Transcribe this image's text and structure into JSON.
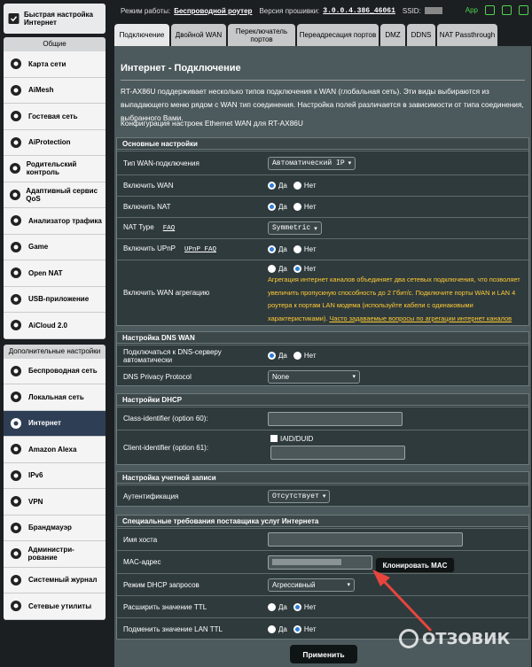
{
  "topbar": {
    "mode_label": "Режим работы:",
    "mode_value": "Беспроводной роутер",
    "fw_label": "Версия прошивки:",
    "fw_value": "3.0.0.4.386_46061",
    "ssid_label": "SSID:",
    "app_label": "App"
  },
  "sidebar": {
    "quick": "Быстрая настройка Интернет",
    "general_header": "Общие",
    "general": [
      {
        "label": "Карта сети",
        "icon": "network-map-icon"
      },
      {
        "label": "AiMesh",
        "icon": "aimesh-icon"
      },
      {
        "label": "Гостевая сеть",
        "icon": "guest-network-icon"
      },
      {
        "label": "AiProtection",
        "icon": "shield-icon"
      },
      {
        "label": "Родительский контроль",
        "icon": "parental-icon"
      },
      {
        "label": "Адаптивный сервис QoS",
        "icon": "qos-icon"
      },
      {
        "label": "Анализатор трафика",
        "icon": "traffic-icon"
      },
      {
        "label": "Game",
        "icon": "gamepad-icon"
      },
      {
        "label": "Open NAT",
        "icon": "open-nat-icon"
      },
      {
        "label": "USB-приложение",
        "icon": "usb-icon"
      },
      {
        "label": "AiCloud 2.0",
        "icon": "cloud-icon"
      }
    ],
    "advanced_header": "Дополнительные настройки",
    "advanced": [
      {
        "label": "Беспроводная сеть",
        "icon": "wireless-icon"
      },
      {
        "label": "Локальная сеть",
        "icon": "lan-icon"
      },
      {
        "label": "Интернет",
        "icon": "globe-icon"
      },
      {
        "label": "Amazon Alexa",
        "icon": "alexa-icon"
      },
      {
        "label": "IPv6",
        "icon": "ipv6-icon"
      },
      {
        "label": "VPN",
        "icon": "vpn-icon"
      },
      {
        "label": "Брандмауэр",
        "icon": "firewall-icon"
      },
      {
        "label": "Администри-рование",
        "icon": "admin-icon"
      },
      {
        "label": "Системный журнал",
        "icon": "log-icon"
      },
      {
        "label": "Сетевые утилиты",
        "icon": "tools-icon"
      }
    ]
  },
  "tabs": [
    "Подключение",
    "Двойной WAN",
    "Переключатель портов",
    "Переадресация портов",
    "DMZ",
    "DDNS",
    "NAT Passthrough"
  ],
  "page": {
    "title": "Интернет - Подключение",
    "description": "RT-AX86U поддерживает несколько типов подключения к WAN (глобальная сеть). Эти виды выбираются из выпадающего меню рядом с WAN тип соединения. Настройка полей различается в зависимости от типа соединения, выбранного Вами.",
    "config": "Конфигурация настроек Ethernet WAN для RT-AX86U"
  },
  "basic": {
    "header": "Основные настройки",
    "wan_type_label": "Тип WAN-подключения",
    "wan_type_value": "Автоматический IP",
    "enable_wan_label": "Включить WAN",
    "enable_nat_label": "Включить NAT",
    "nat_type_label": "NAT Type",
    "nat_faq": "FAQ",
    "nat_type_value": "Symmetric",
    "upnp_label": "Включить UPnP",
    "upnp_faq": "UPnP  FAQ",
    "agg_label": "Включить WAN агрегацию",
    "yes": "Да",
    "no": "Нет",
    "agg_note": "Агрегация интернет каналов объединяет два сетевых подключения, что позволяет увеличить пропускную способность до 2 Гбит/с. Подключите порты WAN и LAN 4 роутера к портам LAN модема (используйте кабели с одинаковыми характеристиками).",
    "agg_link": "Часто задаваемые вопросы по агрегации интернет каналов"
  },
  "dns": {
    "header": "Настройка DNS WAN",
    "auto_label": "Подключаться к DNS-серверу автоматически",
    "privacy_label": "DNS Privacy Protocol",
    "privacy_value": "None"
  },
  "dhcp": {
    "header": "Настройки DHCP",
    "class_label": "Class-identifier (option 60):",
    "client_label": "Client-identifier (option 61):",
    "iaid_label": "IAID/DUID"
  },
  "account": {
    "header": "Настройка учетной записи",
    "auth_label": "Аутентификация",
    "auth_value": "Отсутствует"
  },
  "isp": {
    "header": "Специальные требования поставщика услуг Интернета",
    "host_label": "Имя хоста",
    "mac_label": "MAC-адрес",
    "clone_label": "Клонировать MAC",
    "dhcp_mode_label": "Режим DHCP запросов",
    "dhcp_mode_value": "Агрессивный",
    "ttl_label": "Расширить значение TTL",
    "lan_ttl_label": "Подменить значение LAN TTL"
  },
  "apply_label": "Применить",
  "watermark": "ОТЗОВИК",
  "colors": {
    "accent": "#2f7fd9",
    "note": "#ffcc33",
    "active": "#2e3e55",
    "arrow": "#e8453c"
  }
}
